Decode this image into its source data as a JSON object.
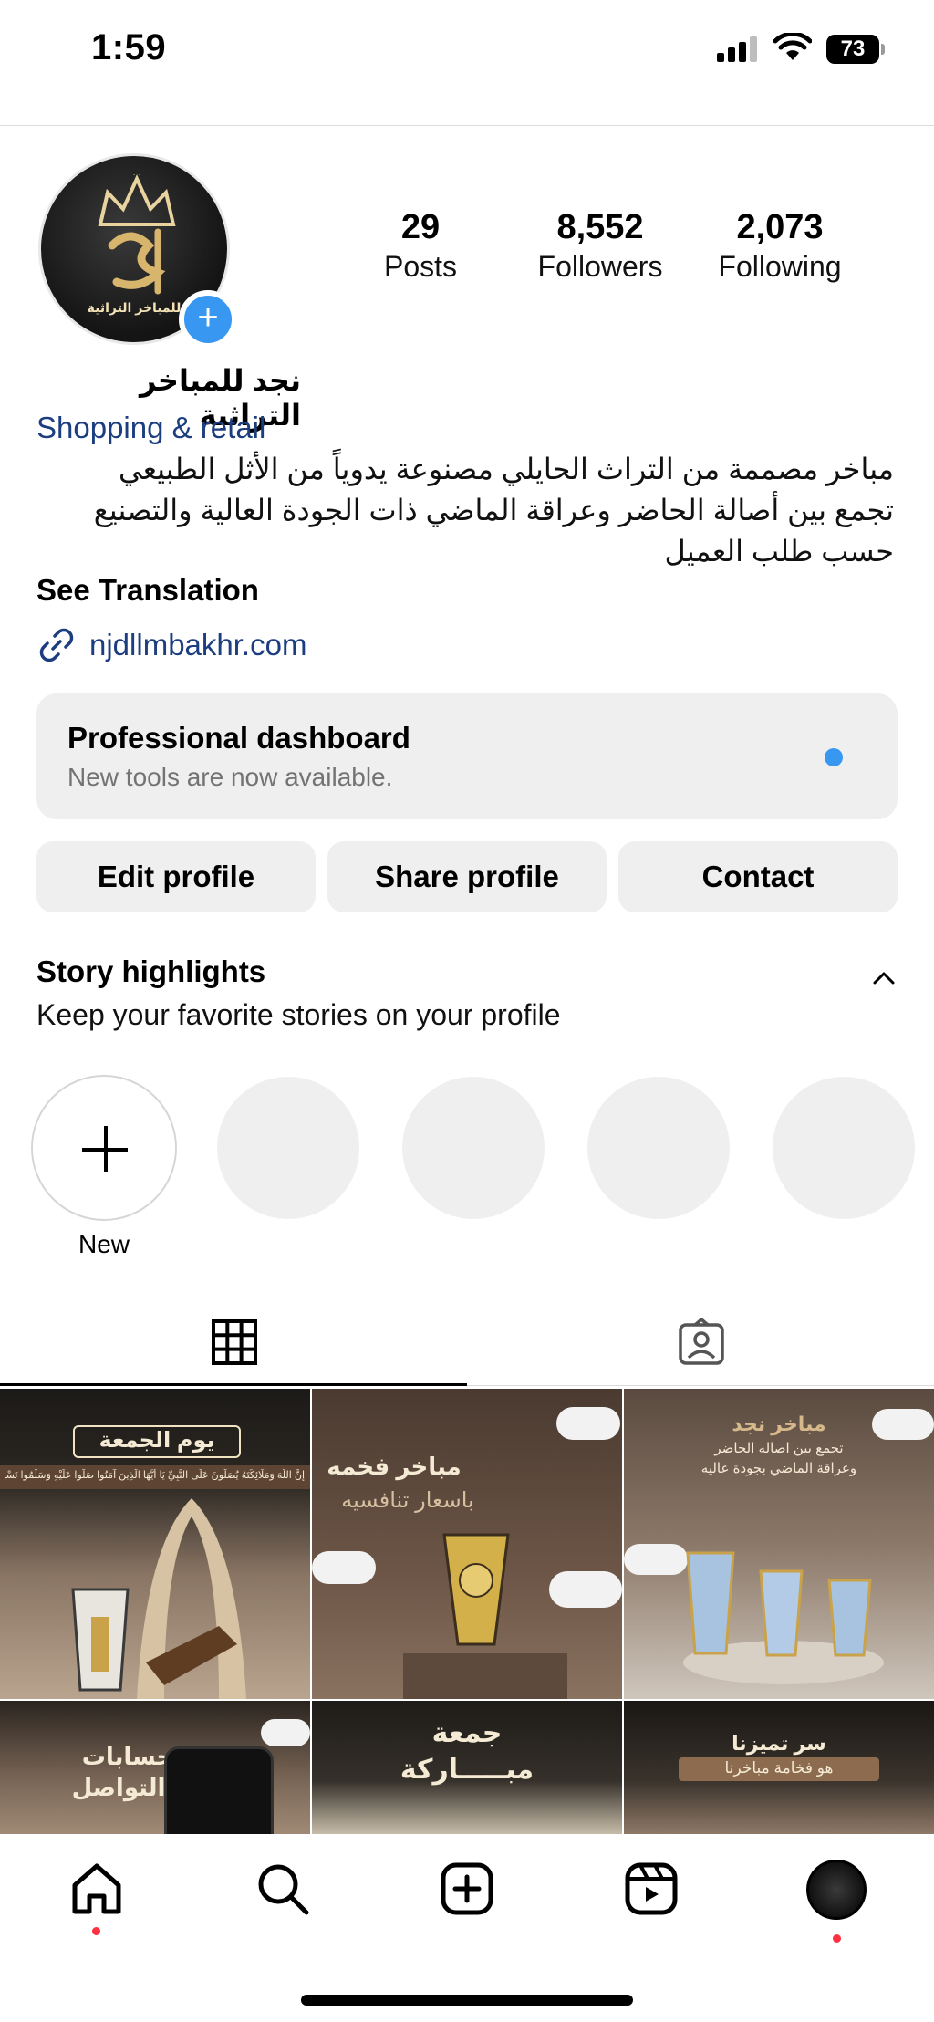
{
  "status_bar": {
    "time": "1:59",
    "battery": "73"
  },
  "profile": {
    "name": "نجد للمباخر التراثية",
    "avatar_caption": "للمباخر التراثية",
    "category": "Shopping & retail",
    "bio_lines": [
      "مباخر مصممة من التراث الحايلي مصنوعة يدوياً من الأثل الطبيعي",
      "تجمع بين أصالة الحاضر وعراقة الماضي ذات الجودة العالية والتصنيع",
      "حسب طلب العميل"
    ],
    "see_translation": "See Translation",
    "link": "njdllmbakhr.com",
    "stats": [
      {
        "value": "29",
        "label": "Posts"
      },
      {
        "value": "8,552",
        "label": "Followers"
      },
      {
        "value": "2,073",
        "label": "Following"
      }
    ]
  },
  "dashboard": {
    "title": "Professional dashboard",
    "subtitle": "New tools are now available."
  },
  "buttons": {
    "edit": "Edit profile",
    "share": "Share profile",
    "contact": "Contact"
  },
  "highlights": {
    "title": "Story highlights",
    "subtitle": "Keep your favorite stories on your profile",
    "new_label": "New"
  },
  "tabs": [
    {
      "icon": "grid-icon",
      "active": true
    },
    {
      "icon": "tagged-icon",
      "active": false
    }
  ],
  "posts": [
    {
      "title": "يوم الجمعة",
      "subtitle": "إِنَّ اللَّهَ وَمَلَائِكَتَهُ يُصَلُّونَ عَلَى النَّبِيِّ يَا أَيُّهَا الَّذِينَ آمَنُوا صَلُّوا عَلَيْهِ وَسَلِّمُوا تَسْلِيمًا"
    },
    {
      "title": "مباخر فخمه",
      "subtitle": "باسعار تنافسيه"
    },
    {
      "title": "مباخر نجد",
      "subtitle": "تجمع بين اصاله الحاضر",
      "subtitle2": "وعراقة الماضي بجودة عاليه"
    },
    {
      "title": "حسابات",
      "subtitle": "التواصل"
    },
    {
      "title": "جمعة",
      "subtitle": "مبـــــاركة"
    },
    {
      "title": "سر تميزنا",
      "subtitle": "هو فخامة مباخرنا"
    }
  ],
  "colors": {
    "link_blue": "#1c3d80",
    "accent_blue": "#3897f0",
    "notification_red": "#ff3040",
    "button_gray": "#efefef"
  },
  "nav": [
    "home-icon",
    "search-icon",
    "create-icon",
    "reels-icon",
    "profile-avatar"
  ]
}
